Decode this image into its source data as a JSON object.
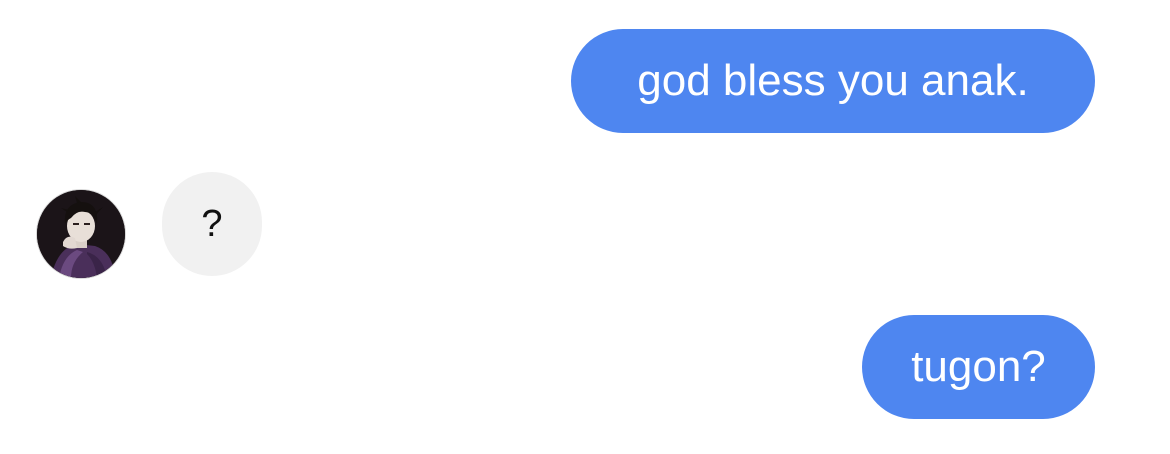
{
  "messages": [
    {
      "direction": "outgoing",
      "text": "god bless you anak."
    },
    {
      "direction": "incoming",
      "text": "?"
    },
    {
      "direction": "outgoing",
      "text": "tugon?"
    }
  ],
  "colors": {
    "outgoing_bubble": "#4E86F0",
    "outgoing_text": "#FFFFFF",
    "incoming_bubble": "#F1F1F1",
    "incoming_text": "#111111",
    "background": "#FFFFFF"
  },
  "avatar": {
    "icon": "contact-avatar"
  }
}
